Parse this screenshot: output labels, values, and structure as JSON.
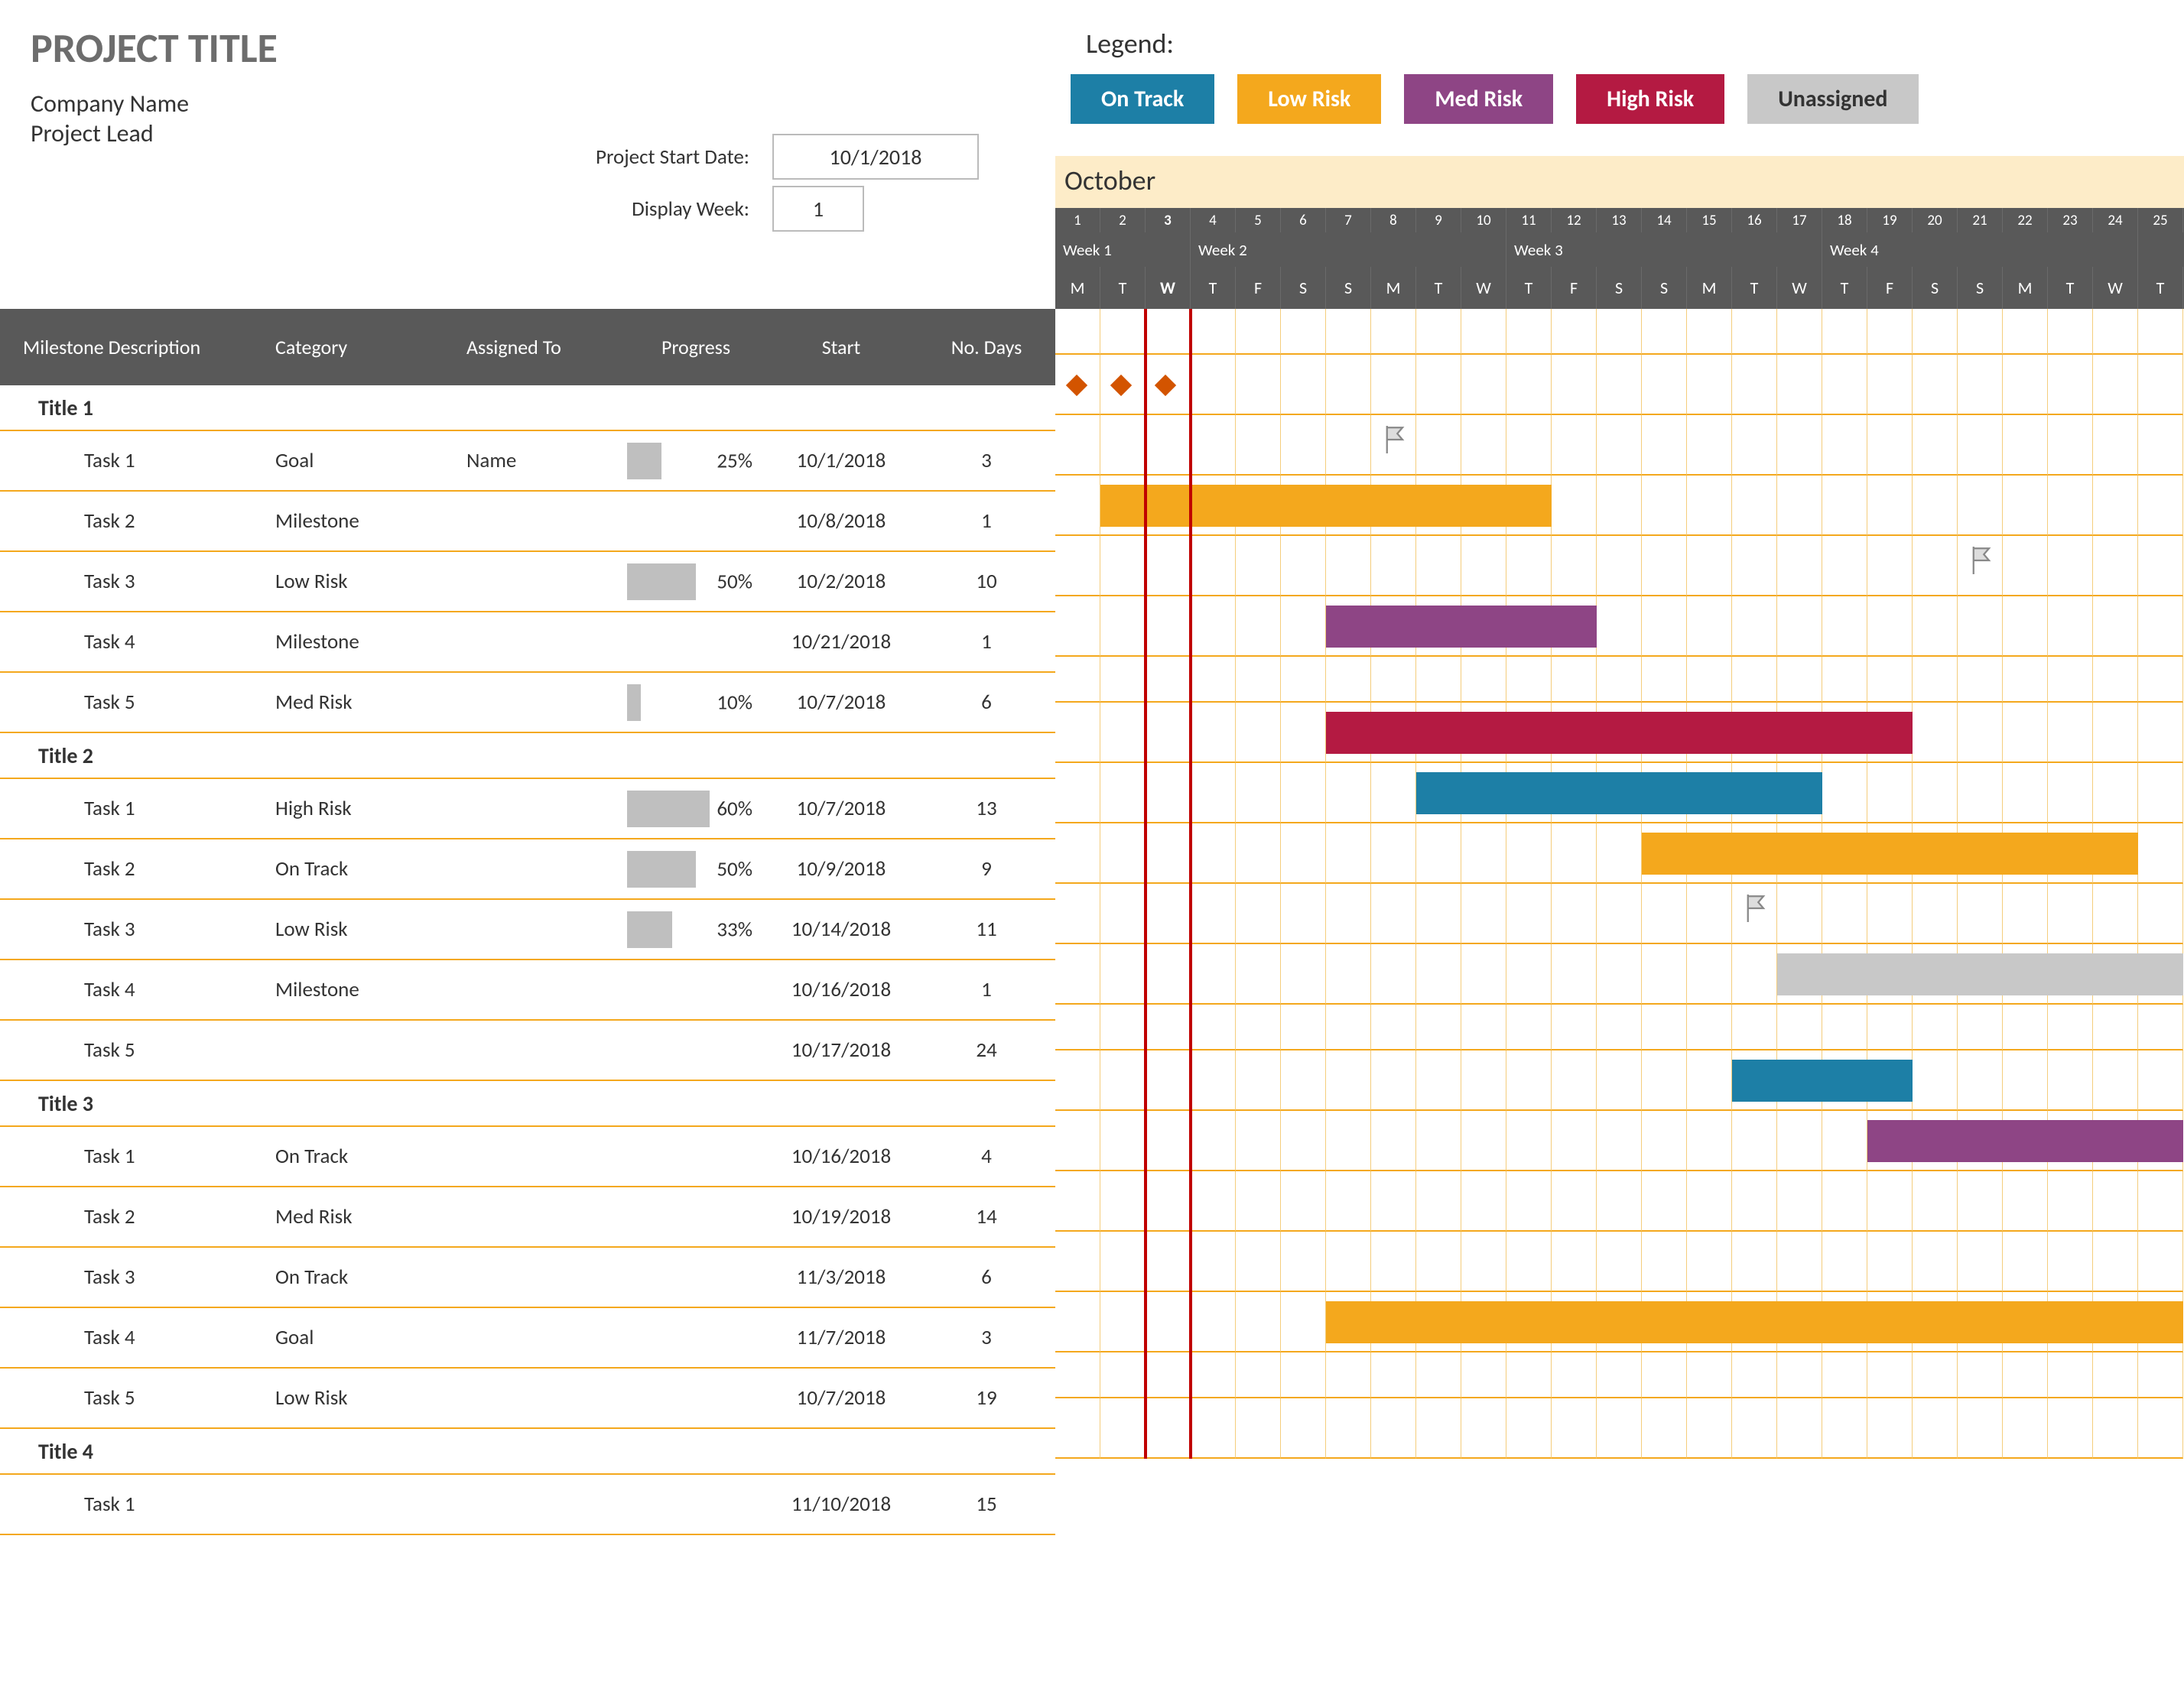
{
  "project_title": "PROJECT TITLE",
  "company_name": "Company Name",
  "project_lead": "Project Lead",
  "start_date_label": "Project Start Date:",
  "start_date": "10/1/2018",
  "display_week_label": "Display Week:",
  "display_week": "1",
  "legend_label": "Legend:",
  "legend": {
    "ontrack": "On Track",
    "lowrisk": "Low Risk",
    "medrisk": "Med Risk",
    "highrisk": "High Risk",
    "unassigned": "Unassigned"
  },
  "month_label": "October",
  "columns": {
    "desc": "Milestone Description",
    "cat": "Category",
    "assign": "Assigned To",
    "prog": "Progress",
    "start": "Start",
    "days": "No. Days"
  },
  "date_numbers": [
    "1",
    "2",
    "3",
    "4",
    "5",
    "6",
    "7",
    "8",
    "9",
    "10",
    "11",
    "12",
    "13",
    "14",
    "15",
    "16",
    "17",
    "18",
    "19",
    "20",
    "21",
    "22",
    "23",
    "24",
    "25"
  ],
  "week_labels": [
    "Week 1",
    "Week 2",
    "Week 3",
    "Week 4"
  ],
  "dow": [
    "M",
    "T",
    "W",
    "T",
    "F",
    "S",
    "S",
    "M",
    "T",
    "W",
    "T",
    "F",
    "S",
    "S",
    "M",
    "T",
    "W",
    "T",
    "F",
    "S",
    "S",
    "M",
    "T",
    "W",
    "T"
  ],
  "today_index": 2,
  "chart_data": {
    "type": "gantt",
    "start_date": "10/1/2018",
    "categories_color": {
      "Goal": "#d35400",
      "Milestone": "flag",
      "Low Risk": "#f4a81d",
      "Med Risk": "#8e4585",
      "High Risk": "#b41a42",
      "On Track": "#1d7fa6",
      "Unassigned": "#c8c8c8"
    },
    "groups": [
      {
        "title": "Title 1",
        "tasks": [
          {
            "name": "Task 1",
            "category": "Goal",
            "assigned": "Name",
            "progress": 25,
            "start": "10/1/2018",
            "days": 3,
            "offset": 0
          },
          {
            "name": "Task 2",
            "category": "Milestone",
            "assigned": "",
            "progress": null,
            "start": "10/8/2018",
            "days": 1,
            "offset": 7
          },
          {
            "name": "Task 3",
            "category": "Low Risk",
            "assigned": "",
            "progress": 50,
            "start": "10/2/2018",
            "days": 10,
            "offset": 1
          },
          {
            "name": "Task 4",
            "category": "Milestone",
            "assigned": "",
            "progress": null,
            "start": "10/21/2018",
            "days": 1,
            "offset": 20
          },
          {
            "name": "Task 5",
            "category": "Med Risk",
            "assigned": "",
            "progress": 10,
            "start": "10/7/2018",
            "days": 6,
            "offset": 6
          }
        ]
      },
      {
        "title": "Title 2",
        "tasks": [
          {
            "name": "Task 1",
            "category": "High Risk",
            "assigned": "",
            "progress": 60,
            "start": "10/7/2018",
            "days": 13,
            "offset": 6
          },
          {
            "name": "Task 2",
            "category": "On Track",
            "assigned": "",
            "progress": 50,
            "start": "10/9/2018",
            "days": 9,
            "offset": 8
          },
          {
            "name": "Task 3",
            "category": "Low Risk",
            "assigned": "",
            "progress": 33,
            "start": "10/14/2018",
            "days": 11,
            "offset": 13
          },
          {
            "name": "Task 4",
            "category": "Milestone",
            "assigned": "",
            "progress": null,
            "start": "10/16/2018",
            "days": 1,
            "offset": 15
          },
          {
            "name": "Task 5",
            "category": "",
            "assigned": "",
            "progress": null,
            "start": "10/17/2018",
            "days": 24,
            "offset": 16
          }
        ]
      },
      {
        "title": "Title 3",
        "tasks": [
          {
            "name": "Task 1",
            "category": "On Track",
            "assigned": "",
            "progress": null,
            "start": "10/16/2018",
            "days": 4,
            "offset": 15
          },
          {
            "name": "Task 2",
            "category": "Med Risk",
            "assigned": "",
            "progress": null,
            "start": "10/19/2018",
            "days": 14,
            "offset": 18
          },
          {
            "name": "Task 3",
            "category": "On Track",
            "assigned": "",
            "progress": null,
            "start": "11/3/2018",
            "days": 6,
            "offset": 33
          },
          {
            "name": "Task 4",
            "category": "Goal",
            "assigned": "",
            "progress": null,
            "start": "11/7/2018",
            "days": 3,
            "offset": 37
          },
          {
            "name": "Task 5",
            "category": "Low Risk",
            "assigned": "",
            "progress": null,
            "start": "10/7/2018",
            "days": 19,
            "offset": 6
          }
        ]
      },
      {
        "title": "Title 4",
        "tasks": [
          {
            "name": "Task 1",
            "category": "",
            "assigned": "",
            "progress": null,
            "start": "11/10/2018",
            "days": 15,
            "offset": 40
          }
        ]
      }
    ]
  }
}
